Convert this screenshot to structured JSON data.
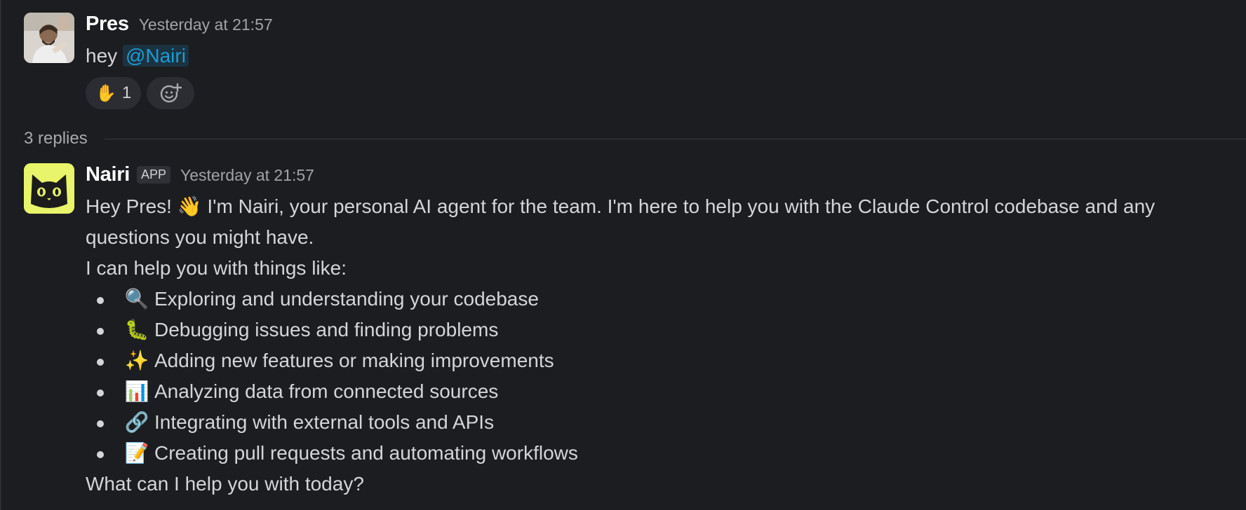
{
  "first_message": {
    "author": "Pres",
    "time": "Yesterday at 21:57",
    "text_prefix": "hey",
    "mention": "@Nairi",
    "reaction": {
      "emoji": "✋",
      "count": "1"
    },
    "add_reaction_icon": "add-reaction-icon"
  },
  "thread": {
    "replies_label": "3 replies"
  },
  "reply": {
    "author": "Nairi",
    "badge": "APP",
    "time": "Yesterday at 21:57",
    "intro_before": "Hey Pres!",
    "intro_emoji": "👋",
    "intro_after": "I'm Nairi, your personal AI agent for the team. I'm here to help you with the Claude Control codebase and any questions you might have.",
    "lead": "I can help you with things like:",
    "items": [
      {
        "emoji": "🔍",
        "text": "Exploring and understanding your codebase"
      },
      {
        "emoji": "🐛",
        "text": "Debugging issues and finding problems"
      },
      {
        "emoji": "✨",
        "text": "Adding new features or making improvements"
      },
      {
        "emoji": "📊",
        "text": "Analyzing data from connected sources"
      },
      {
        "emoji": "🔗",
        "text": "Integrating with external tools and APIs"
      },
      {
        "emoji": "📝",
        "text": "Creating pull requests and automating workflows"
      }
    ],
    "closing": "What can I help you with today?"
  },
  "colors": {
    "background": "#1b1d21",
    "mention": "#1d9bd1",
    "cat_avatar_bg": "#e8f56a"
  }
}
